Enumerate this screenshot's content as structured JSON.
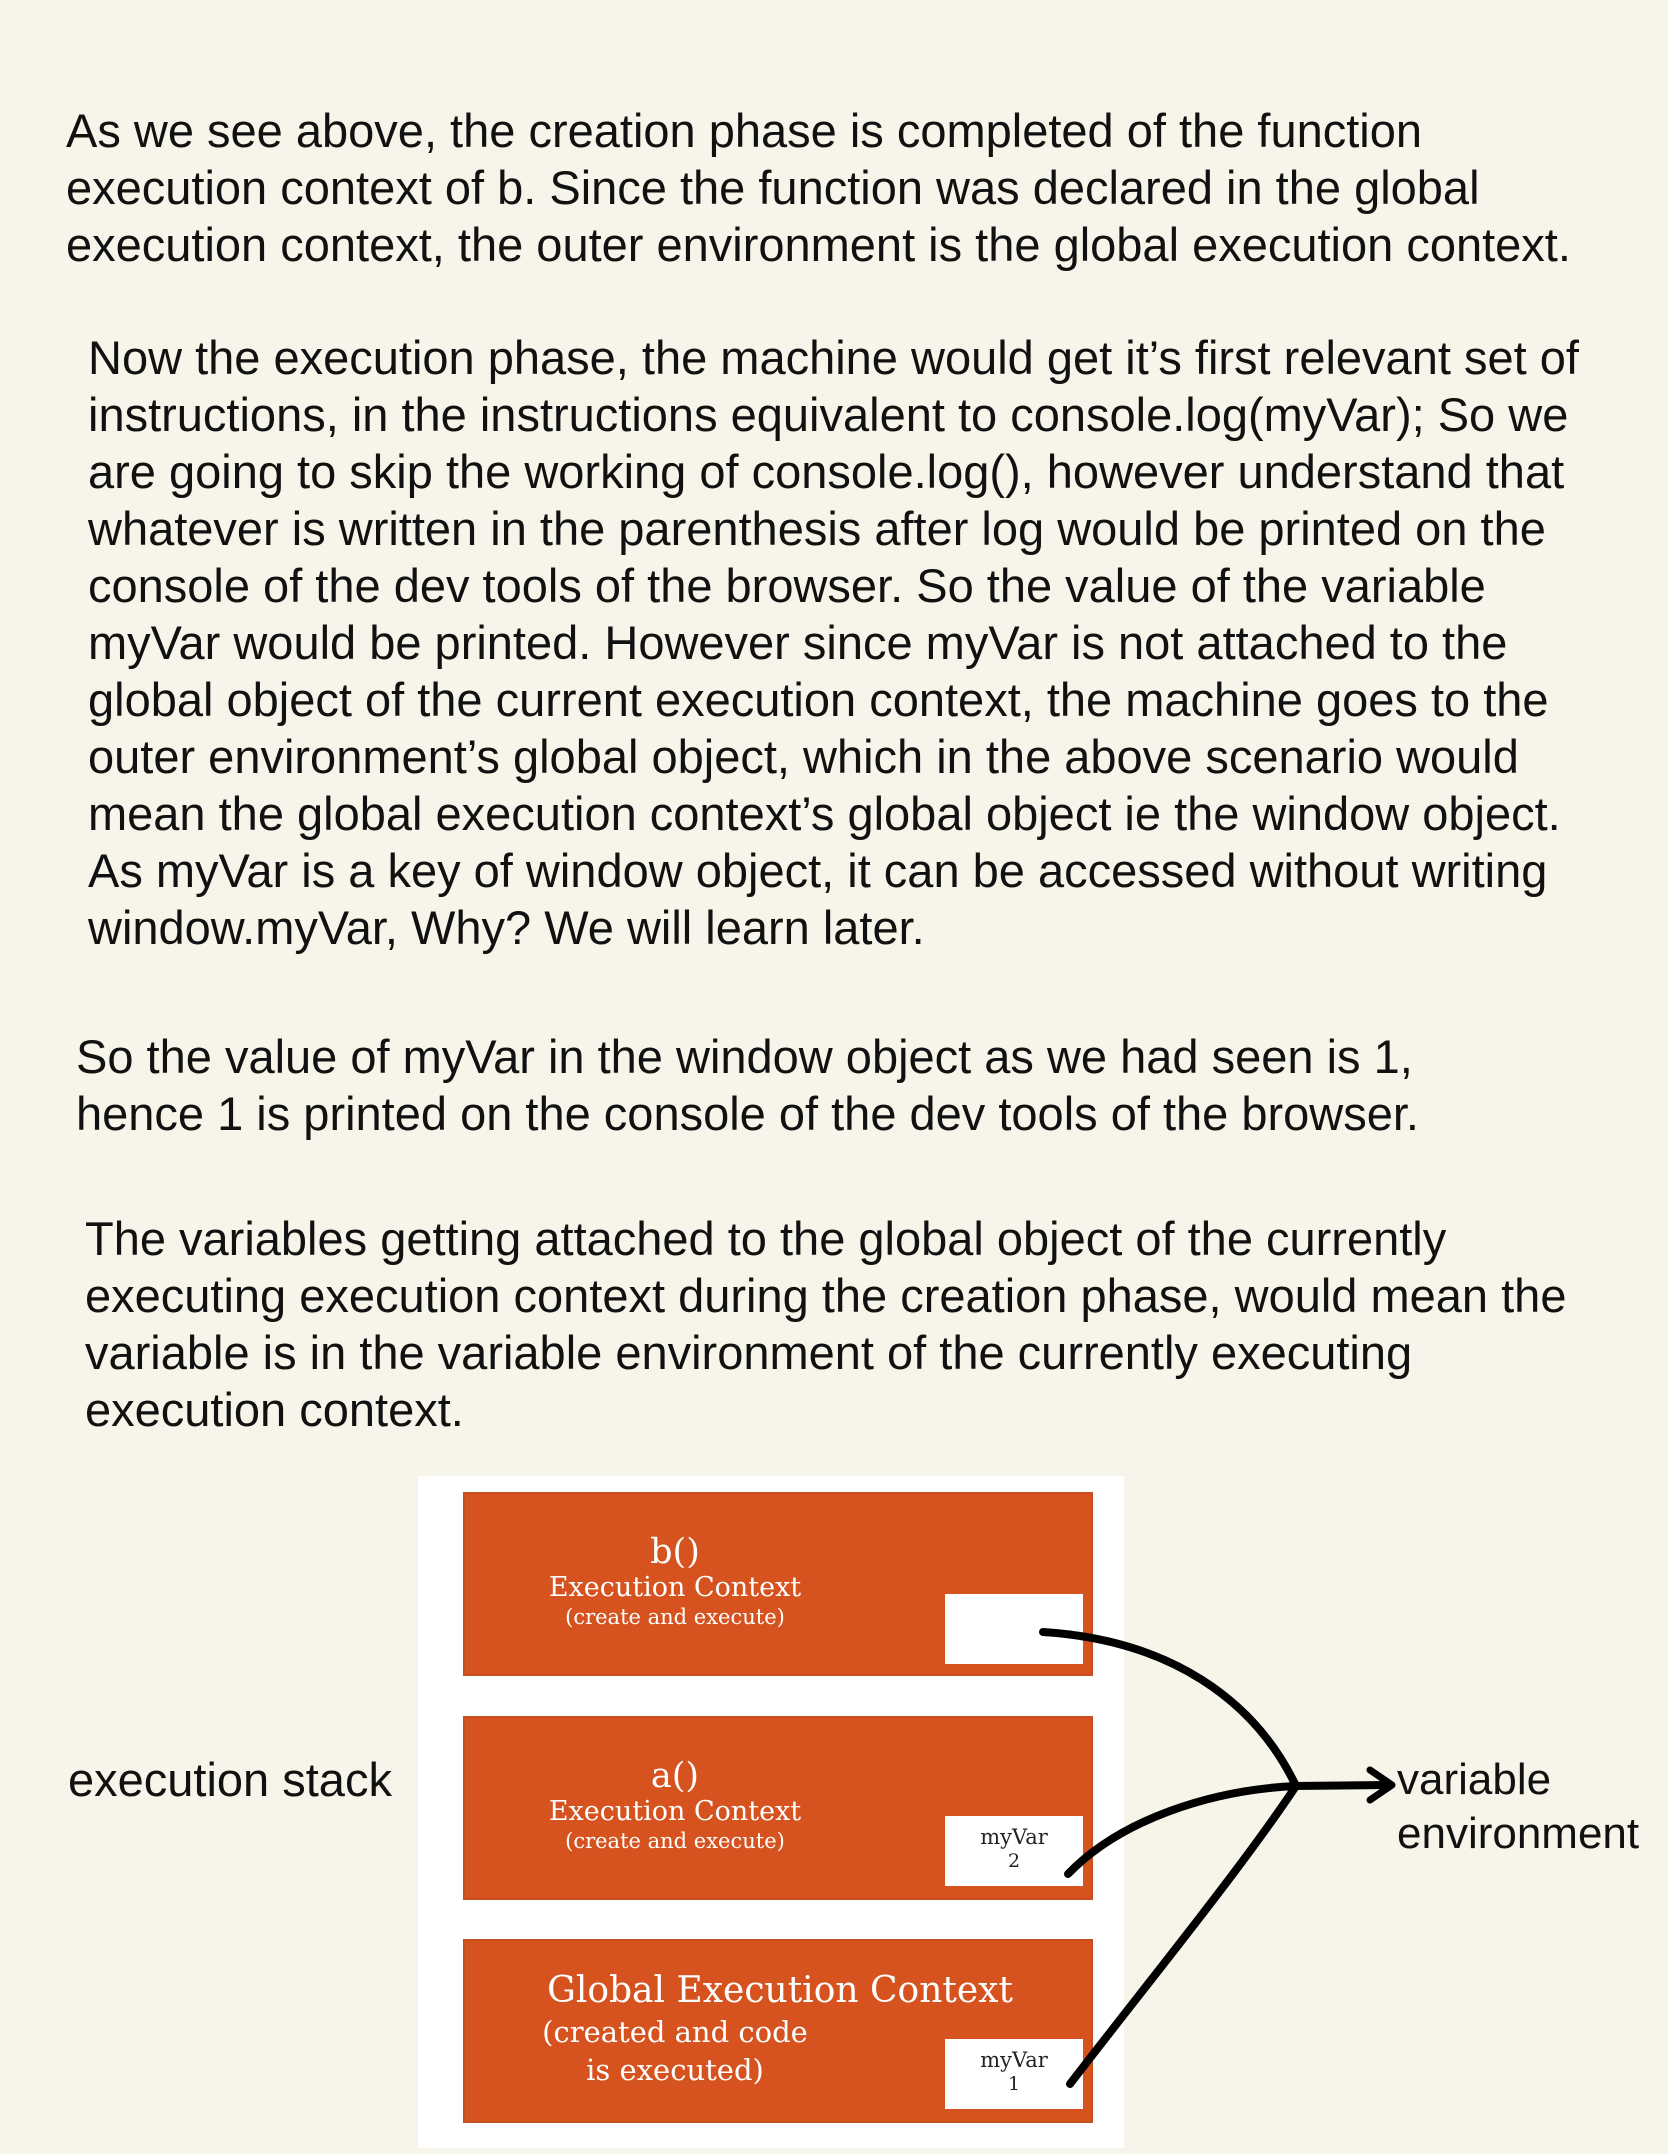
{
  "paragraphs": {
    "p1": [
      "As we see above, the creation phase is completed of the function",
      "execution context of b. Since the function was declared in the global",
      "execution context, the outer environment is the global execution context."
    ],
    "p2": [
      "Now the execution phase, the machine would get it’s first relevant set of",
      "instructions, in the instructions equivalent to console.log(myVar); So we",
      "are going to skip the working of console.log(), however understand that",
      "whatever is written in the parenthesis after log would be printed on the",
      "console of the dev tools of the browser. So the value of the variable",
      "myVar would be printed. However since myVar is not attached to the",
      "global object of the current execution context, the machine goes to the",
      "outer environment’s global object, which in the above scenario would",
      "mean the global execution context’s global object ie the window object.",
      "As myVar is a key of window object, it can be accessed without writing",
      "window.myVar, Why? We will learn later."
    ],
    "p3": [
      "So the value of myVar in the window object as we had seen is 1,",
      "hence 1 is printed on the console of the dev tools of the browser."
    ],
    "p4": [
      "The variables getting attached to the global object of the currently",
      "executing execution context during the creation phase, would mean the",
      "variable is in the variable environment of the currently executing",
      "execution context."
    ]
  },
  "diagram": {
    "stack_label": "execution stack",
    "env_label": [
      "variable",
      "environment"
    ],
    "contexts": {
      "b": {
        "name": "b()",
        "title": "Execution Context",
        "subtitle": "(create and execute)",
        "var_name": "",
        "var_value": ""
      },
      "a": {
        "name": "a()",
        "title": "Execution Context",
        "subtitle": "(create and execute)",
        "var_name": "myVar",
        "var_value": "2"
      },
      "global": {
        "title": "Global Execution Context",
        "subtitle": [
          "(created and code",
          "is executed)"
        ],
        "var_name": "myVar",
        "var_value": "1"
      }
    },
    "colors": {
      "context_fill": "#d6531f",
      "background": "#f7f5e9",
      "arrow": "#000000"
    }
  }
}
